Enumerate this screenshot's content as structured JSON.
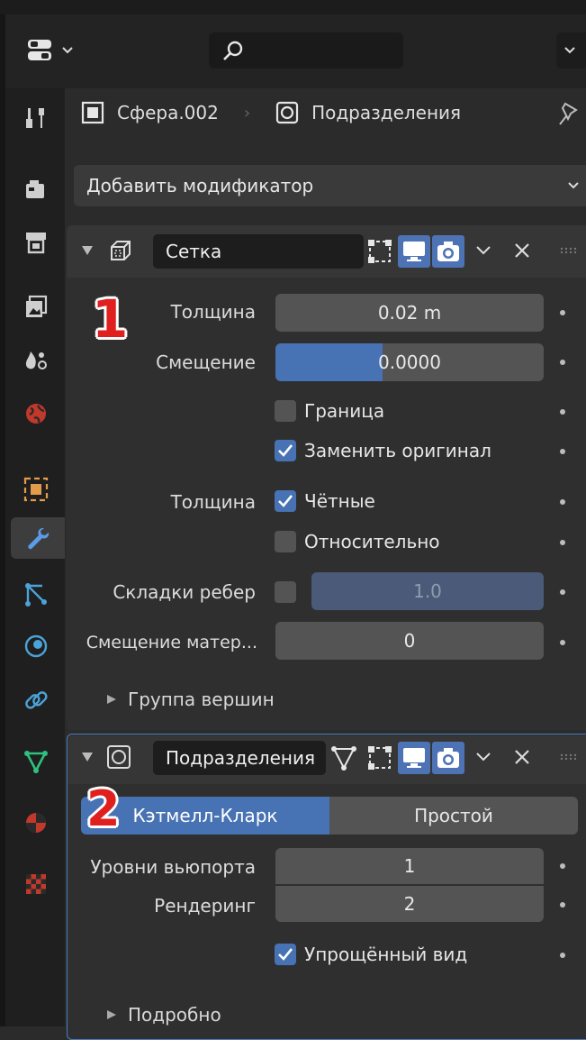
{
  "breadcrumb": {
    "object": "Сфера.002",
    "modifier": "Подразделения"
  },
  "add_modifier": "Добавить модификатор",
  "modifier1": {
    "name": "Сетка",
    "annotation": "1",
    "thickness_label": "Толщина",
    "thickness_value": "0.02 m",
    "offset_label": "Смещение",
    "offset_value": "0.0000",
    "offset_fill": 0.4,
    "boundary_label": "Граница",
    "boundary_checked": false,
    "replace_label": "Заменить оригинал",
    "replace_checked": true,
    "thickness2_label": "Толщина",
    "even_label": "Чётные",
    "even_checked": true,
    "relative_label": "Относительно",
    "relative_checked": false,
    "crease_label": "Складки ребер",
    "crease_checked": false,
    "crease_value": "1.0",
    "material_offset_label": "Смещение матер...",
    "material_offset_value": "0",
    "vertex_group_label": "Группа вершин"
  },
  "modifier2": {
    "name": "Подразделения",
    "annotation": "2",
    "mode_options": [
      "Кэтмелл-Кларк",
      "Простой"
    ],
    "mode_selected": "Кэтмелл-Кларк",
    "viewport_label": "Уровни вьюпорта",
    "viewport_value": "1",
    "render_label": "Рендеринг",
    "render_value": "2",
    "optimal_label": "Упрощённый вид",
    "optimal_checked": true,
    "advanced_label": "Подробно"
  },
  "colors": {
    "accent": "#4772b3",
    "annotation": "#e01f1f",
    "background": "#2b2b2b"
  },
  "tabs": [
    "tool-icon",
    "render-icon",
    "output-icon",
    "view-layer-icon",
    "scene-icon",
    "world-icon",
    "object-icon",
    "modifier-icon",
    "particles-icon",
    "physics-icon",
    "constraints-icon",
    "data-icon",
    "material-icon",
    "texture-icon"
  ]
}
